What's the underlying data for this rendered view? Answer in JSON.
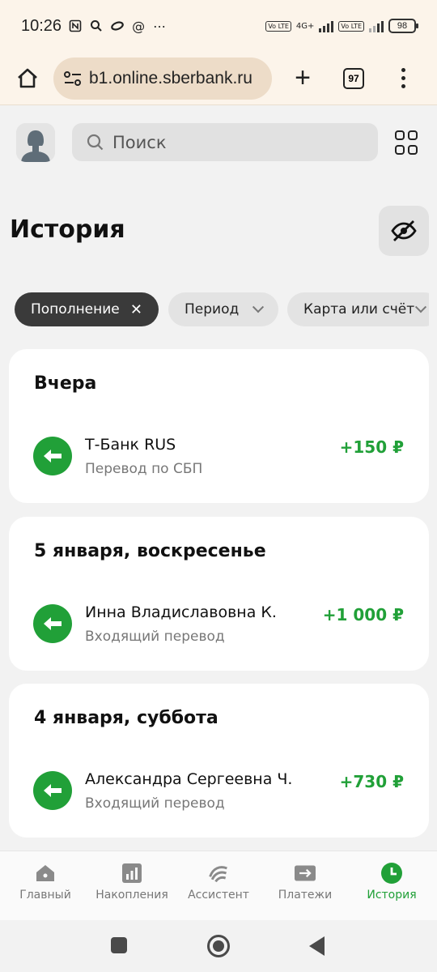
{
  "status_bar": {
    "time": "10:26",
    "battery": "98",
    "network_label": "4G+",
    "volte_label": "Vo LTE"
  },
  "browser": {
    "url": "b1.online.sberbank.ru",
    "tab_count": "97"
  },
  "header": {
    "search_placeholder": "Поиск"
  },
  "page": {
    "title": "История"
  },
  "filters": {
    "active_chip": "Пополнение",
    "period_chip": "Период",
    "card_chip": "Карта или счёт"
  },
  "groups": [
    {
      "date": "Вчера",
      "transaction": {
        "name": "Т-Банк RUS",
        "description": "Перевод по СБП",
        "amount": "+150 ₽"
      }
    },
    {
      "date": "5 января, воскресенье",
      "transaction": {
        "name": "Инна Владиславовна К.",
        "description": "Входящий перевод",
        "amount": "+1 000 ₽"
      }
    },
    {
      "date": "4 января, суббота",
      "transaction": {
        "name": "Александра Сергеевна Ч.",
        "description": "Входящий перевод",
        "amount": "+730 ₽"
      }
    }
  ],
  "bottom_nav": [
    {
      "label": "Главный",
      "icon": "home-icon",
      "active": false
    },
    {
      "label": "Накопления",
      "icon": "chart-icon",
      "active": false
    },
    {
      "label": "Ассистент",
      "icon": "assistant-icon",
      "active": false
    },
    {
      "label": "Платежи",
      "icon": "payments-icon",
      "active": false
    },
    {
      "label": "История",
      "icon": "history-icon",
      "active": true
    }
  ],
  "colors": {
    "accent_green": "#21a038",
    "chip_active": "#3a3a3a",
    "browser_bar": "#fcf4ea"
  }
}
